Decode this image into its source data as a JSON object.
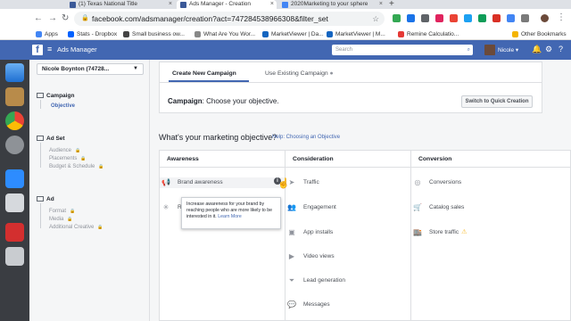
{
  "browser": {
    "tabs": [
      {
        "label": "(1) Texas National Title",
        "color": "#3b5998"
      },
      {
        "label": "Ads Manager - Creation",
        "color": "#3b5998"
      },
      {
        "label": "2020Marketing to your sphere",
        "color": "#4285f4"
      }
    ],
    "url": "facebook.com/adsmanager/creation?act=747284538966308&filter_set",
    "bookmarks": [
      "Apps",
      "Stats - Dropbox",
      "Small business ow...",
      "What Are You Wor...",
      "MarketViewer | Da...",
      "MarketViewer | M...",
      "Remine Calculatio..."
    ],
    "other_bookmarks": "Other Bookmarks"
  },
  "fb": {
    "logo": "f",
    "app_title": "Ads Manager",
    "search_placeholder": "Search",
    "user": "Nicole"
  },
  "sidebar": {
    "account": "Nicole Boynton (74728...",
    "campaign": {
      "label": "Campaign",
      "items": [
        {
          "label": "Objective"
        }
      ]
    },
    "adset": {
      "label": "Ad Set",
      "items": [
        {
          "label": "Audience"
        },
        {
          "label": "Placements"
        },
        {
          "label": "Budget & Schedule"
        }
      ]
    },
    "ad": {
      "label": "Ad",
      "items": [
        {
          "label": "Format"
        },
        {
          "label": "Media"
        },
        {
          "label": "Additional Creative"
        }
      ]
    }
  },
  "main": {
    "tab_create": "Create New Campaign",
    "tab_existing": "Use Existing Campaign",
    "campaign_label": "Campaign",
    "campaign_prompt": ": Choose your objective.",
    "quick_creation_button": "Switch to Quick Creation",
    "objective_question": "What's your marketing objective?",
    "help_link": "Help: Choosing an Objective",
    "columns": {
      "awareness": {
        "header": "Awareness",
        "items": [
          {
            "label": "Brand awareness",
            "icon": "megaphone-icon"
          },
          {
            "label": "Reach",
            "icon": "asterisk-icon"
          }
        ]
      },
      "consideration": {
        "header": "Consideration",
        "items": [
          {
            "label": "Traffic",
            "icon": "cursor-icon"
          },
          {
            "label": "Engagement",
            "icon": "people-icon"
          },
          {
            "label": "App installs",
            "icon": "box-icon"
          },
          {
            "label": "Video views",
            "icon": "video-icon"
          },
          {
            "label": "Lead generation",
            "icon": "funnel-icon"
          },
          {
            "label": "Messages",
            "icon": "chat-icon"
          }
        ]
      },
      "conversion": {
        "header": "Conversion",
        "items": [
          {
            "label": "Conversions",
            "icon": "globe-icon"
          },
          {
            "label": "Catalog sales",
            "icon": "cart-icon"
          },
          {
            "label": "Store traffic",
            "icon": "store-icon"
          }
        ]
      }
    },
    "tooltip": {
      "text": "Increase awareness for your brand by reaching people who are more likely to be interested in it.",
      "link": "Learn More"
    }
  }
}
